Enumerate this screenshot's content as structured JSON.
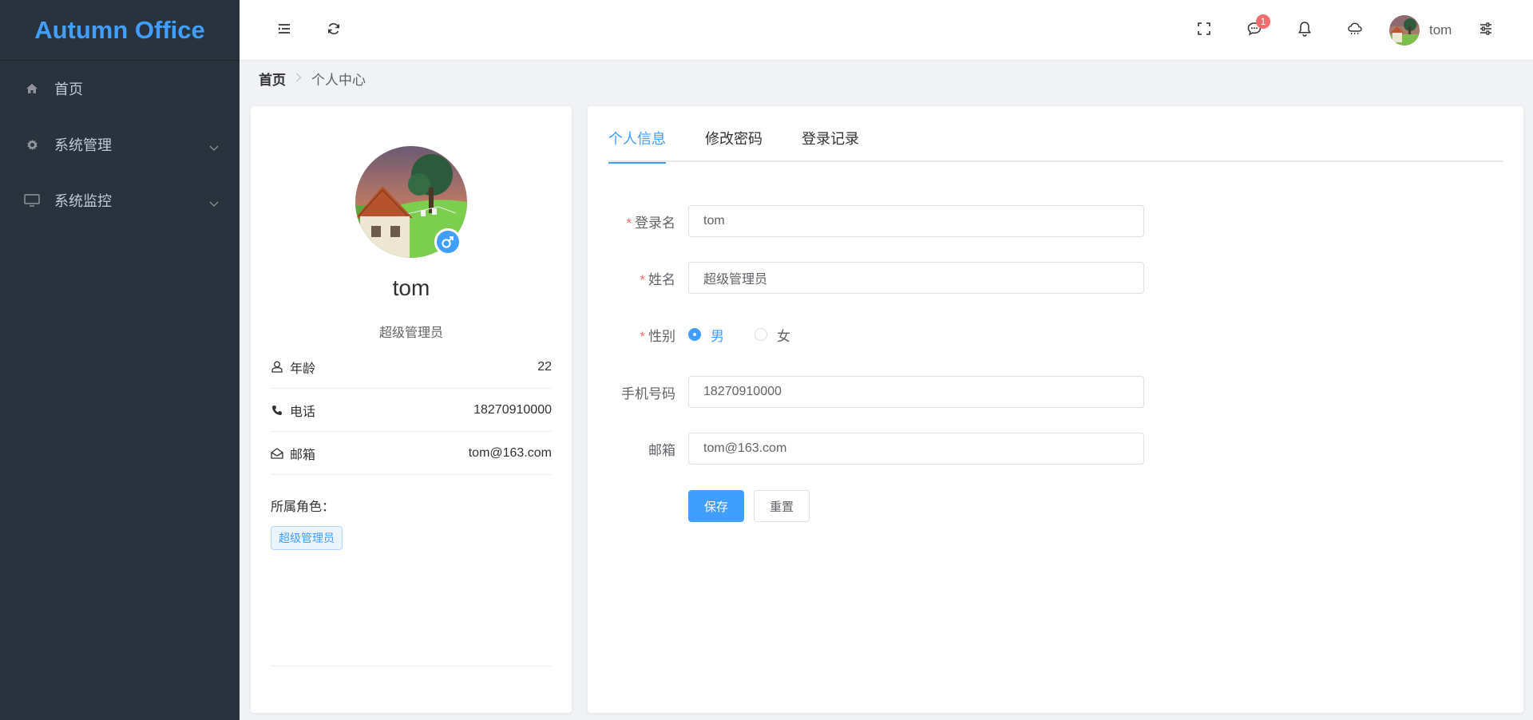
{
  "app": {
    "title": "Autumn Office"
  },
  "sidebar": {
    "items": [
      {
        "label": "首页",
        "icon": "home-icon"
      },
      {
        "label": "系统管理",
        "icon": "gear-icon",
        "expandable": true
      },
      {
        "label": "系统监控",
        "icon": "monitor-icon",
        "expandable": true
      }
    ]
  },
  "header": {
    "message_badge": "1",
    "username": "tom",
    "icons": [
      "menu-fold-icon",
      "refresh-icon",
      "fullscreen-icon",
      "message-icon",
      "bell-icon",
      "cloud-icon",
      "settings-sliders-icon"
    ]
  },
  "breadcrumb": {
    "home": "首页",
    "current": "个人中心"
  },
  "profile": {
    "name": "tom",
    "role": "超级管理员",
    "gender_icon": "male-icon",
    "age_label": "年龄",
    "age": "22",
    "phone_label": "电话",
    "phone": "18270910000",
    "email_label": "邮箱",
    "email": "tom@163.com",
    "roles_title": "所属角色：",
    "roles": [
      "超级管理员"
    ]
  },
  "tabs": [
    {
      "label": "个人信息",
      "active": true
    },
    {
      "label": "修改密码",
      "active": false
    },
    {
      "label": "登录记录",
      "active": false
    }
  ],
  "form": {
    "login_name": {
      "label": "登录名",
      "required": true,
      "value": "tom"
    },
    "real_name": {
      "label": "姓名",
      "required": true,
      "value": "超级管理员"
    },
    "gender": {
      "label": "性别",
      "required": true,
      "options": [
        "男",
        "女"
      ],
      "selected": "男"
    },
    "mobile": {
      "label": "手机号码",
      "required": false,
      "value": "18270910000"
    },
    "email": {
      "label": "邮箱",
      "required": false,
      "value": "tom@163.com"
    },
    "required_mark": "*",
    "save_label": "保存",
    "reset_label": "重置"
  },
  "colors": {
    "primary": "#409eff",
    "sidebar_bg": "#28333e",
    "danger": "#f56c6c"
  }
}
